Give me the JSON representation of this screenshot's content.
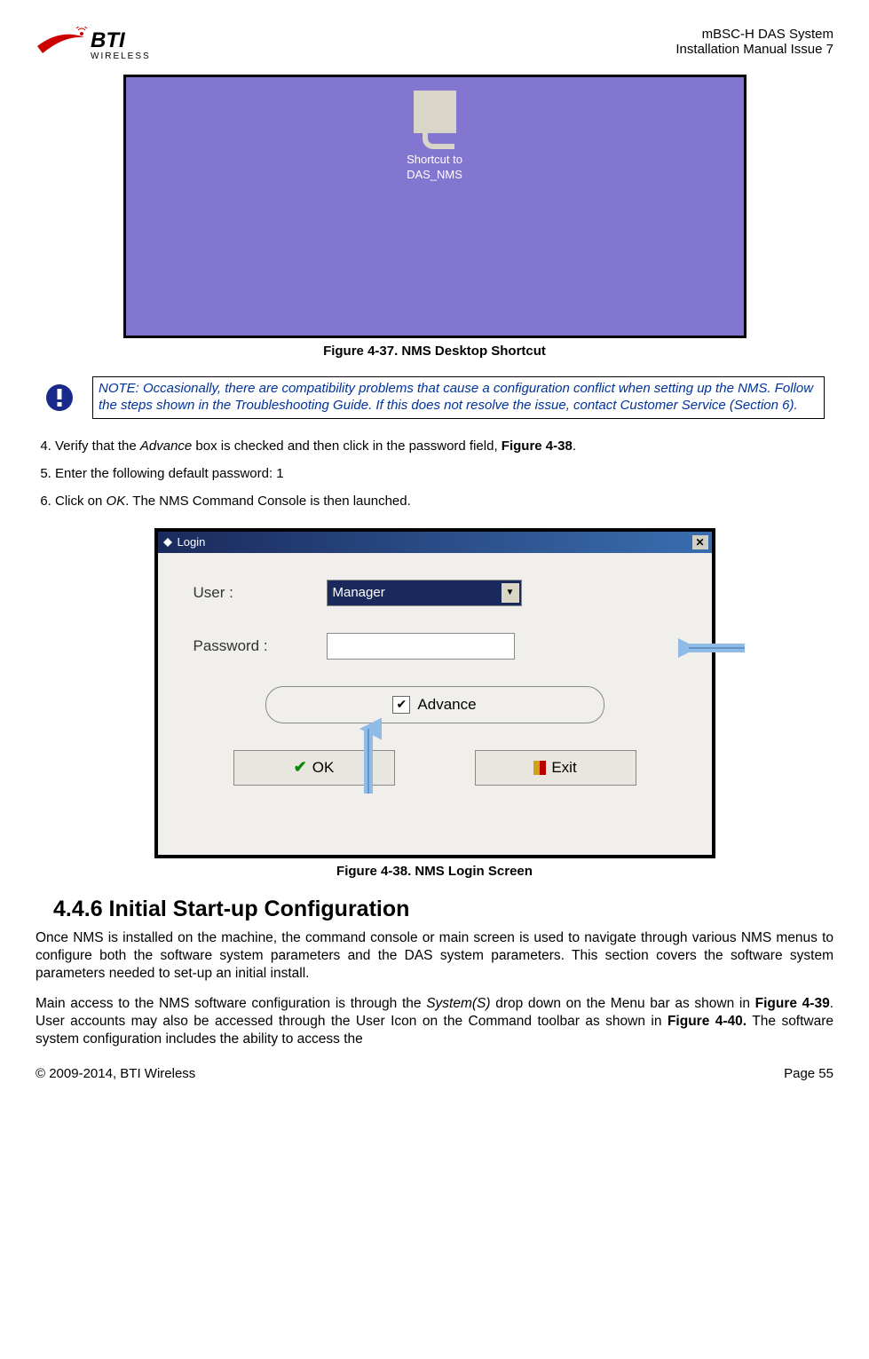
{
  "header": {
    "logo_text": "BTI",
    "logo_sub": "WIRELESS",
    "line1": "mBSC-H DAS System",
    "line2": "Installation Manual Issue 7"
  },
  "fig37": {
    "shortcut_line1": "Shortcut to",
    "shortcut_line2": "DAS_NMS",
    "caption": "Figure 4-37. NMS Desktop Shortcut"
  },
  "note": {
    "text": "NOTE: Occasionally, there are compatibility problems that cause a configuration conflict when setting up the NMS. Follow the steps shown in the Troubleshooting Guide. If this does not resolve the issue, contact Customer Service (Section 6)."
  },
  "steps": {
    "s4_pre": "Verify that the ",
    "s4_ital": "Advance",
    "s4_mid": " box is checked and then click in the password field, ",
    "s4_bold": "Figure 4-38",
    "s4_end": ".",
    "s5": "Enter the following default password: 1",
    "s6_pre": "Click on ",
    "s6_ital": "OK",
    "s6_end": ". The NMS Command Console is then launched."
  },
  "login": {
    "title": "Login",
    "user_label": "User :",
    "user_value": "Manager",
    "password_label": "Password :",
    "advance_label": "Advance",
    "ok_label": "OK",
    "exit_label": "Exit"
  },
  "fig38_caption": "Figure 4-38. NMS Login Screen",
  "section": {
    "heading": "4.4.6  Initial Start-up Configuration",
    "p1": "Once NMS is installed on the machine, the command console or main screen is used to navigate through various NMS menus to configure both the software system parameters and the DAS system parameters. This section covers the software system parameters needed to set-up an initial install.",
    "p2_a": "Main access to the NMS software configuration is through the ",
    "p2_i1": "System(S)",
    "p2_b": " drop down on the Menu bar as shown in ",
    "p2_bold1": "Figure 4-39",
    "p2_c": ". User accounts may also be accessed through the User Icon on the Command toolbar as shown in ",
    "p2_bold2": "Figure 4-40.",
    "p2_d": " The software system configuration includes the ability to access the"
  },
  "footer": {
    "left": "© 2009-2014, BTI Wireless",
    "right": "Page 55"
  }
}
